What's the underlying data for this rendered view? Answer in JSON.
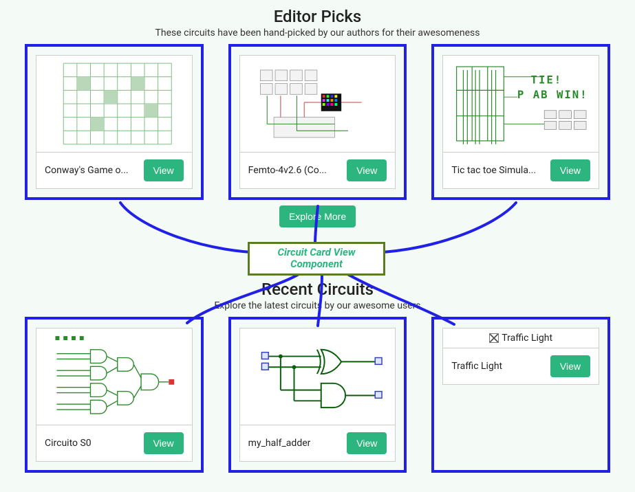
{
  "colors": {
    "accent": "#2cb57e",
    "outline": "#2020e6",
    "componentBorder": "#5a7d22"
  },
  "editor": {
    "title": "Editor Picks",
    "subtitle": "These circuits have been hand-picked by our authors for their awesomeness",
    "cards": [
      {
        "title": "Conway's Game o...",
        "view": "View"
      },
      {
        "title": "Femto-4v2.6 (Co...",
        "view": "View"
      },
      {
        "title": "Tic tac toe Simula...",
        "view": "View"
      }
    ],
    "exploreMore": "Explore More"
  },
  "componentLabel": "Circuit Card View Component",
  "recent": {
    "title": "Recent Circuits",
    "subtitle": "Explore the latest circuits by our awesome users",
    "cards": [
      {
        "title": "Circuito S0",
        "view": "View"
      },
      {
        "title": "my_half_adder",
        "view": "View"
      },
      {
        "title": "Traffic Light",
        "view": "View",
        "brokenAlt": "Traffic Light"
      }
    ]
  }
}
